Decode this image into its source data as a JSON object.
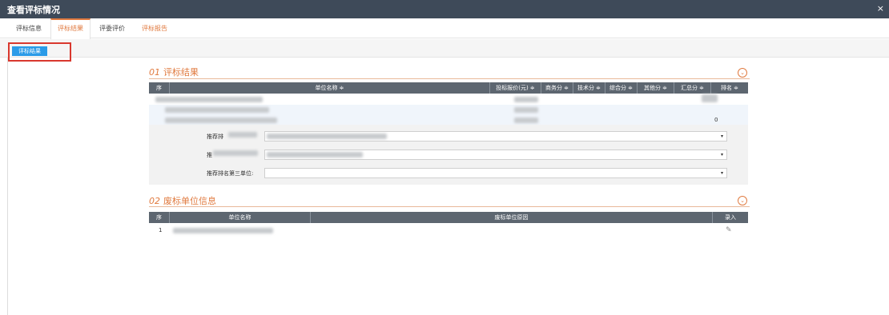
{
  "window": {
    "title": "查看评标情况",
    "close": "×"
  },
  "tabs": [
    {
      "label": "评标信息"
    },
    {
      "label": "评标结果"
    },
    {
      "label": "评委评价"
    },
    {
      "label": "评标报告"
    }
  ],
  "toolbar": {
    "result_button": "评标结果"
  },
  "section1": {
    "number": "01",
    "title": "评标结果",
    "columns": [
      "序",
      "单位名称 ≑",
      "投标报价(元) ≑",
      "商务分 ≑",
      "技术分 ≑",
      "综合分 ≑",
      "其他分 ≑",
      "汇总分 ≑",
      "排名 ≑"
    ],
    "rows": [
      {
        "seq": "",
        "rank": ""
      },
      {
        "seq": "",
        "rank": "0"
      }
    ],
    "recommend": {
      "first_label": "推荐排",
      "second_label": "推",
      "third_label": "推荐排名第三单位:"
    },
    "dropdown_caret": "▾"
  },
  "section2": {
    "number": "02",
    "title": "废标单位信息",
    "columns": [
      "序",
      "单位名称",
      "废标单位原因",
      "录入"
    ],
    "rows": [
      {
        "seq": "1"
      }
    ]
  },
  "icons": {
    "collapse": "⌄",
    "edit": "✎"
  }
}
